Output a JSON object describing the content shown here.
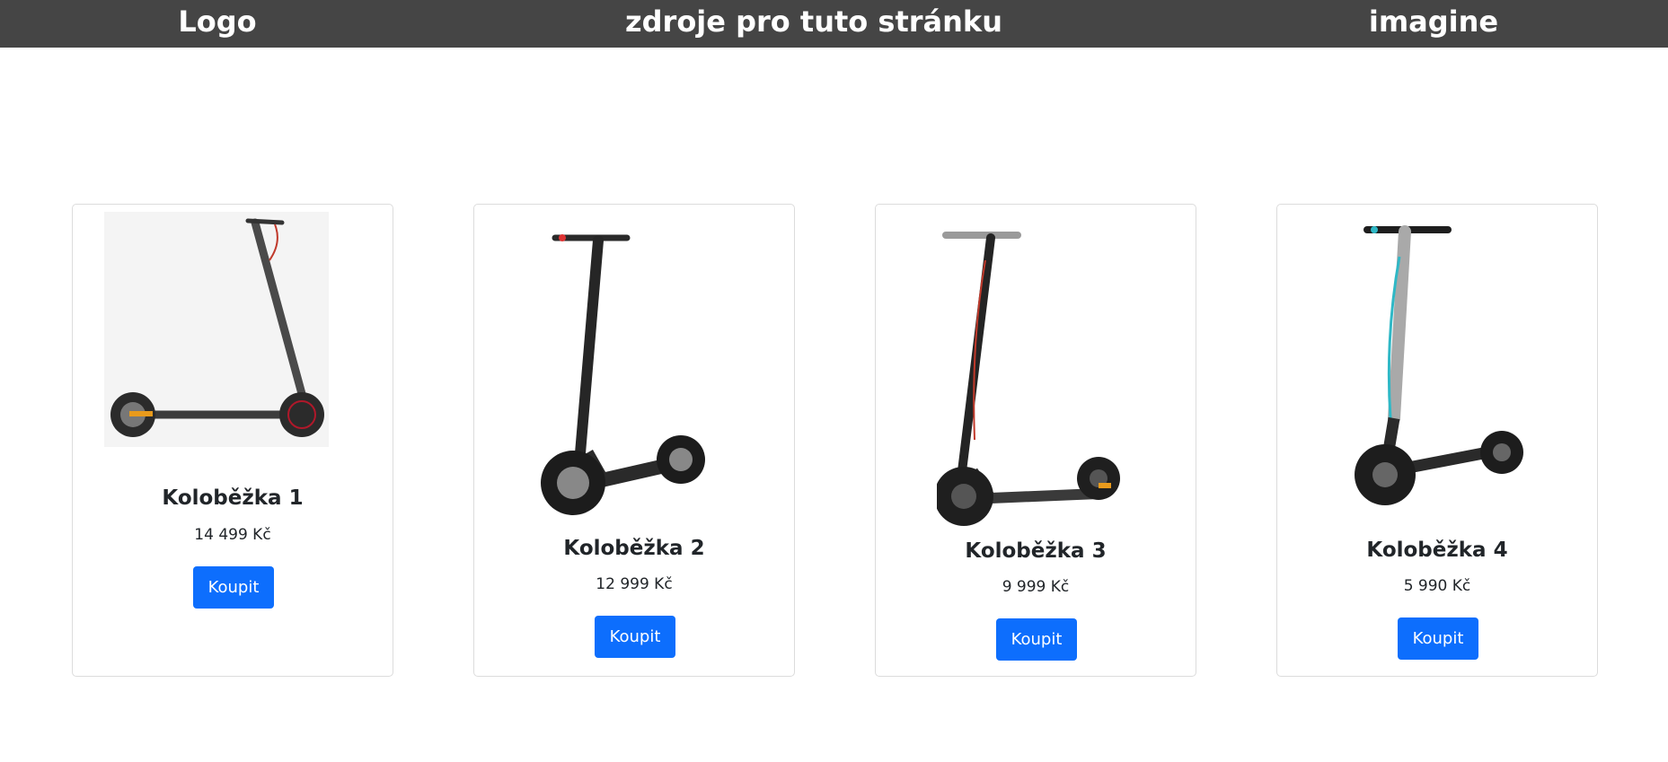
{
  "header": {
    "logo": "Logo",
    "resources_link": "zdroje pro tuto stránku",
    "images_link": "imagine",
    "background": "#454545"
  },
  "products": [
    {
      "name": "Koloběžka 1",
      "price": "14 499 Kč",
      "button": "Koupit",
      "image_icon": "scooter-1-image"
    },
    {
      "name": "Koloběžka 2",
      "price": "12 999 Kč",
      "button": "Koupit",
      "image_icon": "scooter-2-image"
    },
    {
      "name": "Koloběžka 3",
      "price": "9 999 Kč",
      "button": "Koupit",
      "image_icon": "scooter-3-image"
    },
    {
      "name": "Koloběžka 4",
      "price": "5 990 Kč",
      "button": "Koupit",
      "image_icon": "scooter-4-image"
    }
  ],
  "colors": {
    "button": "#0d6efd",
    "card_border": "#dcdcdc"
  }
}
